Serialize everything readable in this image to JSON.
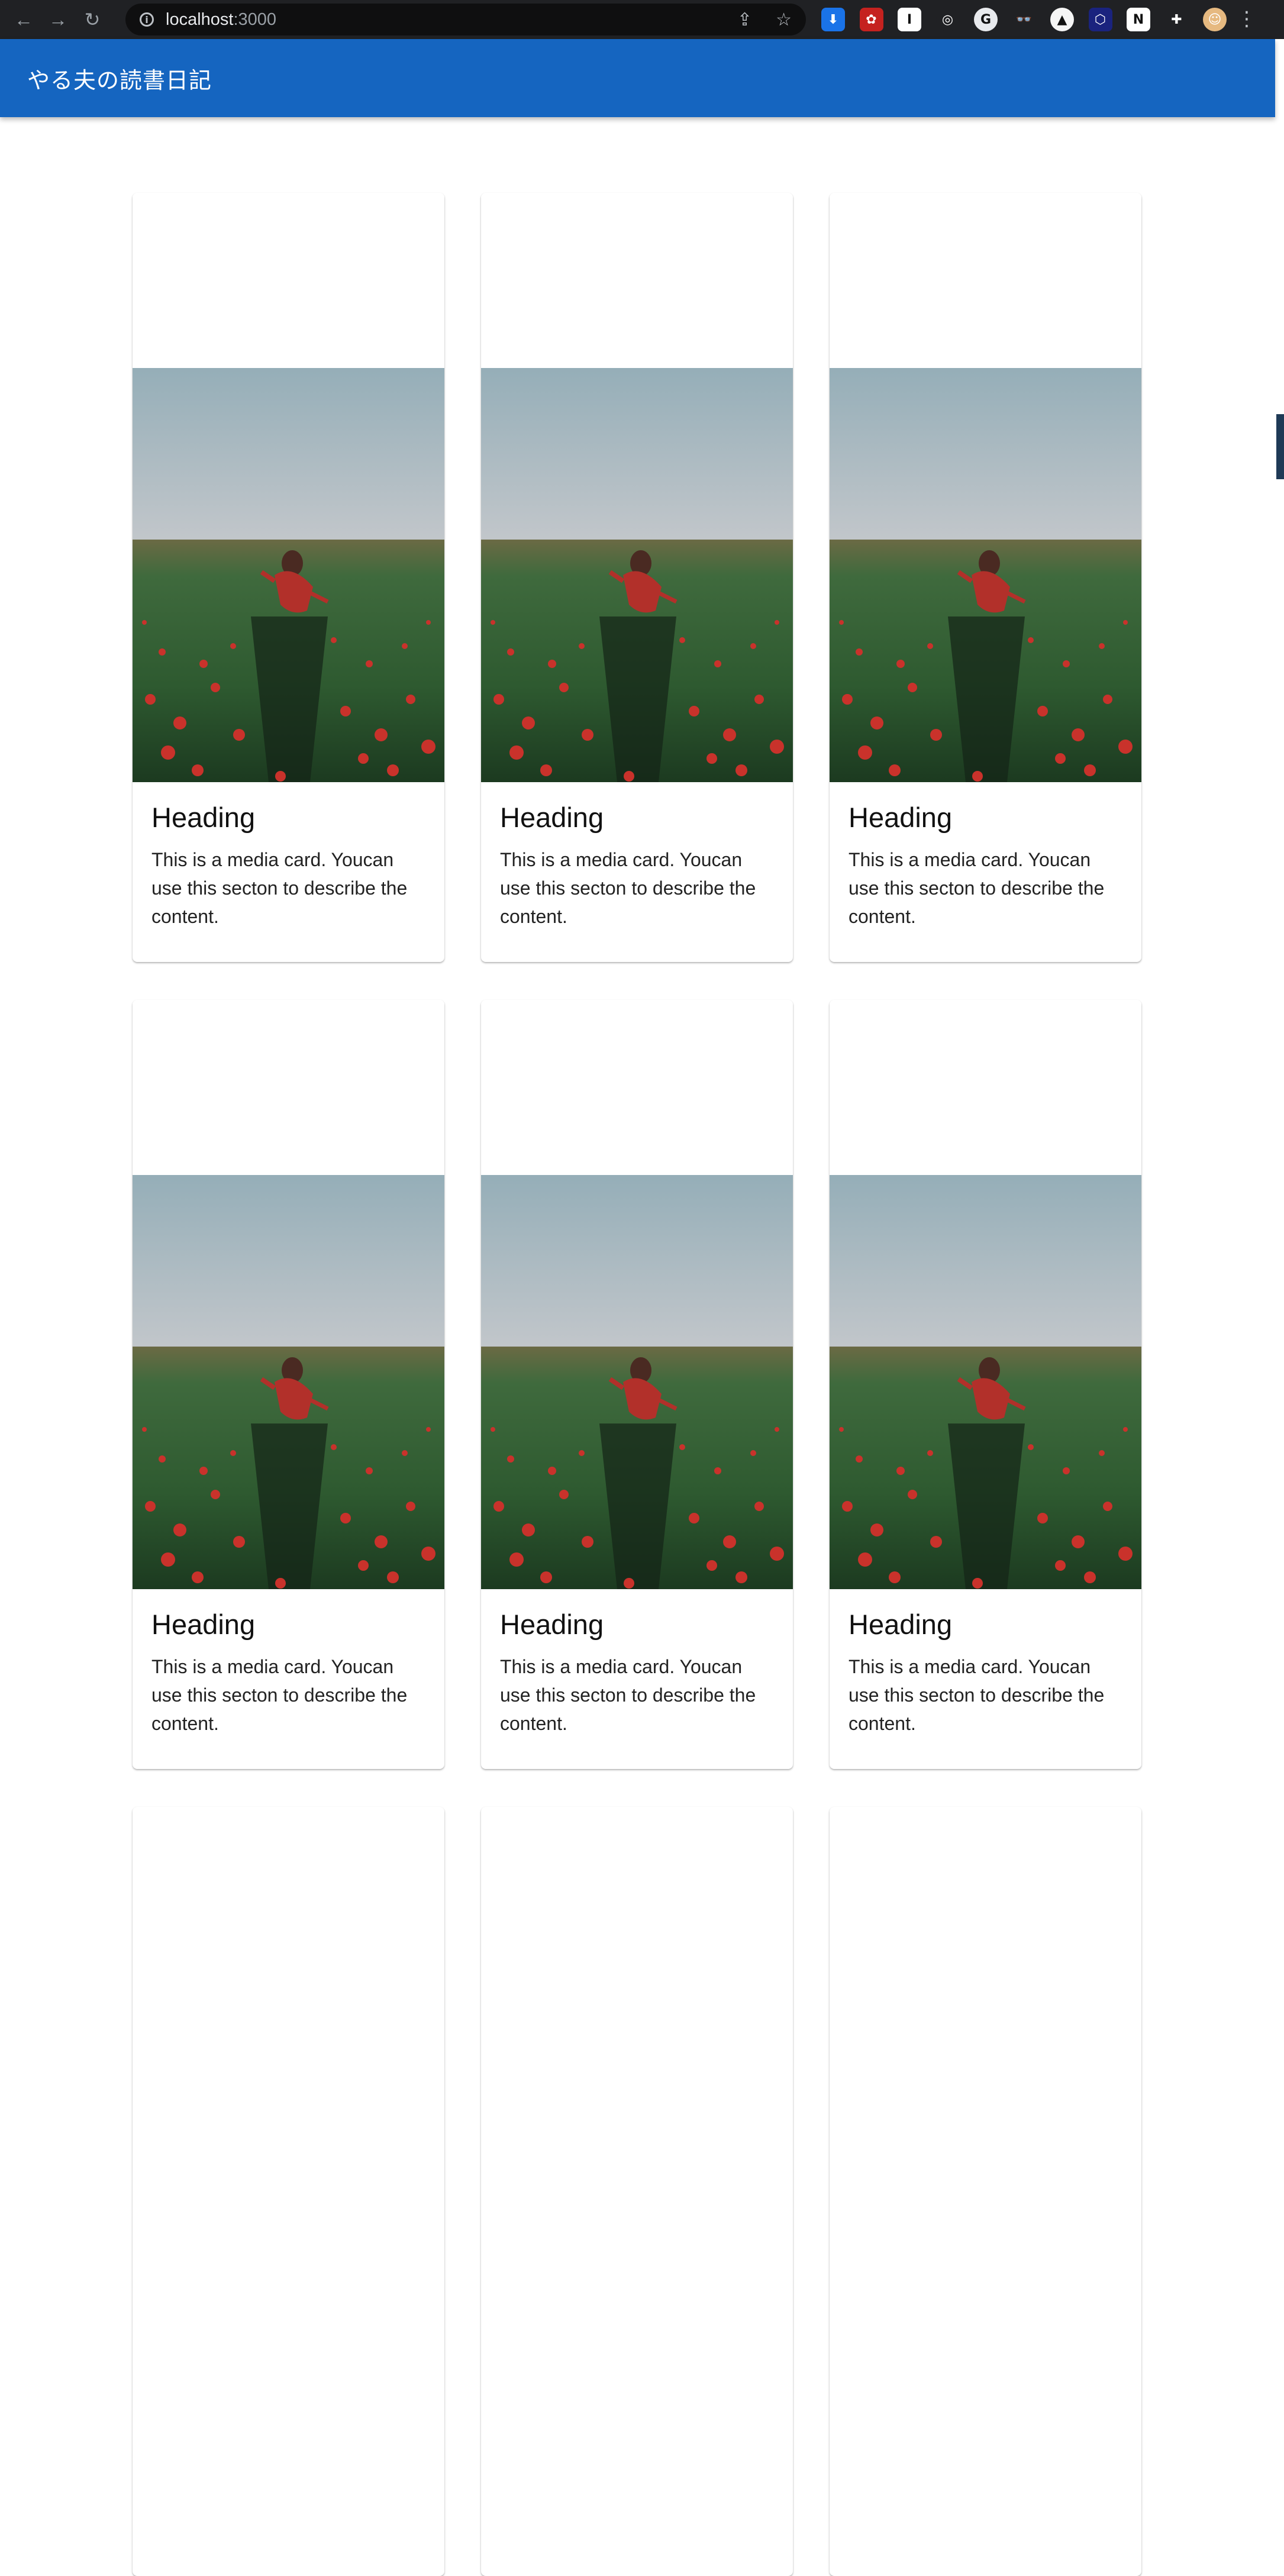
{
  "browser": {
    "url_host": "localhost",
    "url_port": ":3000",
    "extensions": [
      {
        "name": "download-extension-icon",
        "glyph": "⬇",
        "bg": "#1a73e8"
      },
      {
        "name": "red-bug-extension-icon",
        "glyph": "✿",
        "bg": "#c5221f"
      },
      {
        "name": "instapaper-extension-icon",
        "glyph": "I",
        "bg": "#ffffff"
      },
      {
        "name": "target-extension-icon",
        "glyph": "◎",
        "bg": "#202124"
      },
      {
        "name": "grammar-extension-icon",
        "glyph": "G",
        "bg": "#e8eaed"
      },
      {
        "name": "glasses-extension-icon",
        "glyph": "👓",
        "bg": "#202124"
      },
      {
        "name": "orange-extension-icon",
        "glyph": "▲",
        "bg": "#f5f5f5"
      },
      {
        "name": "hex-extension-icon",
        "glyph": "⬡",
        "bg": "#1a237e"
      },
      {
        "name": "notion-extension-icon",
        "glyph": "N",
        "bg": "#ffffff"
      },
      {
        "name": "puzzle-extension-icon",
        "glyph": "✚",
        "bg": "#202124"
      },
      {
        "name": "profile-avatar",
        "glyph": "☺",
        "bg": "#e6b980"
      }
    ]
  },
  "app": {
    "title": "やる夫の読書日記",
    "accent": "#1565c0"
  },
  "cards": [
    {
      "heading": "Heading",
      "text": "This is a media card. Youcan use this secton to describe the content."
    },
    {
      "heading": "Heading",
      "text": "This is a media card. Youcan use this secton to describe the content."
    },
    {
      "heading": "Heading",
      "text": "This is a media card. Youcan use this secton to describe the content."
    },
    {
      "heading": "Heading",
      "text": "This is a media card. Youcan use this secton to describe the content."
    },
    {
      "heading": "Heading",
      "text": "This is a media card. Youcan use this secton to describe the content."
    },
    {
      "heading": "Heading",
      "text": "This is a media card. Youcan use this secton to describe the content."
    }
  ]
}
